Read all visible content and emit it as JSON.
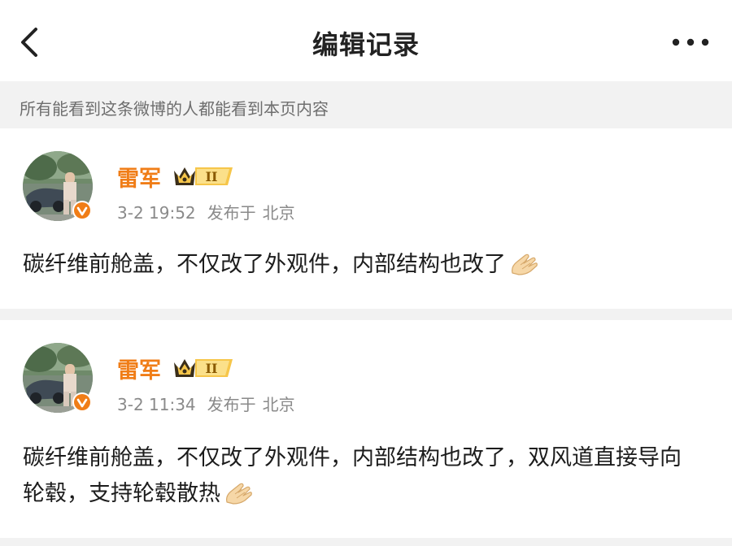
{
  "nav": {
    "title": "编辑记录"
  },
  "notice": {
    "text": "所有能看到这条微博的人都能看到本页内容"
  },
  "posts": [
    {
      "user": "雷军",
      "time": "3-2 19:52",
      "source_label": "发布于",
      "location": "北京",
      "text": "碳纤维前舱盖，不仅改了外观件，内部结构也改了",
      "emoji": "folded-hands-emoji"
    },
    {
      "user": "雷军",
      "time": "3-2 11:34",
      "source_label": "发布于",
      "location": "北京",
      "text": "碳纤维前舱盖，不仅改了外观件，内部结构也改了，双风道直接导向轮毂，支持轮毂散热",
      "emoji": "folded-hands-emoji"
    }
  ],
  "colors": {
    "username": "#f07d17",
    "verified": "#f07d17",
    "meta": "#8a8a8a",
    "notice_bg": "#f2f2f2"
  }
}
